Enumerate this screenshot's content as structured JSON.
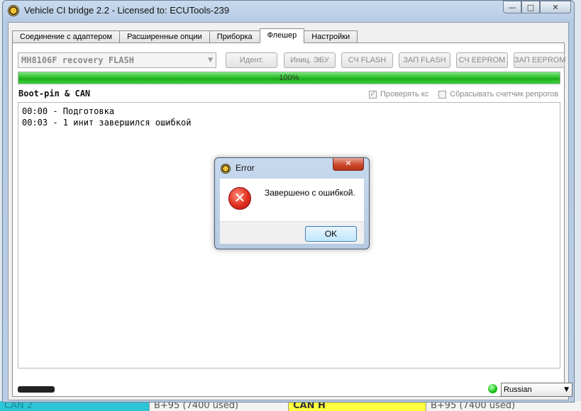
{
  "window": {
    "title": "Vehicle CI bridge  2.2 - Licensed to: ECUTools-239",
    "minimize_glyph": "—",
    "maximize_glyph": "□",
    "close_glyph": "✕"
  },
  "tabs": [
    {
      "label": "Соединение с адаптером",
      "active": false
    },
    {
      "label": "Расширенные опции",
      "active": false
    },
    {
      "label": "Приборка",
      "active": false
    },
    {
      "label": "Флешер",
      "active": true
    },
    {
      "label": "Настройки",
      "active": false
    }
  ],
  "flasher": {
    "ecu_select_value": "MH8106F recovery FLASH",
    "select_arrow": "▼",
    "buttons": {
      "ident": "Идент.",
      "init_ecu": "Иниц. ЭБУ",
      "read_flash": "СЧ FLASH",
      "write_flash": "ЗАП FLASH",
      "read_eeprom": "СЧ EEPROM",
      "write_eeprom": "ЗАП EEPROM"
    },
    "progress_percent": 100,
    "progress_label": "100%",
    "section_label": "Boot-pin & CAN",
    "checkbox_checksum": {
      "label": "Проверять кс",
      "checked": true
    },
    "checkbox_reset_counter": {
      "label": "Сбрасывать счетчик репрогов",
      "checked": false
    },
    "log_lines": [
      "00:00 - Подготовка",
      "00:03 - 1 инит завершился ошибкой"
    ]
  },
  "status_bar": {
    "redacted_text": "",
    "connection_color": "#13c313",
    "language_value": "Russian",
    "language_arrow": "▼"
  },
  "dialog": {
    "title": "Error",
    "close_glyph": "✕",
    "error_glyph": "✕",
    "message": "Завершено с ошибкой.",
    "ok_label": "OK"
  },
  "desktop_strip": {
    "seg1": "CAN 2",
    "seg2": "B+95 (7400 used)",
    "seg3": "CAN H",
    "seg4": "B+95 (7400 used)"
  }
}
